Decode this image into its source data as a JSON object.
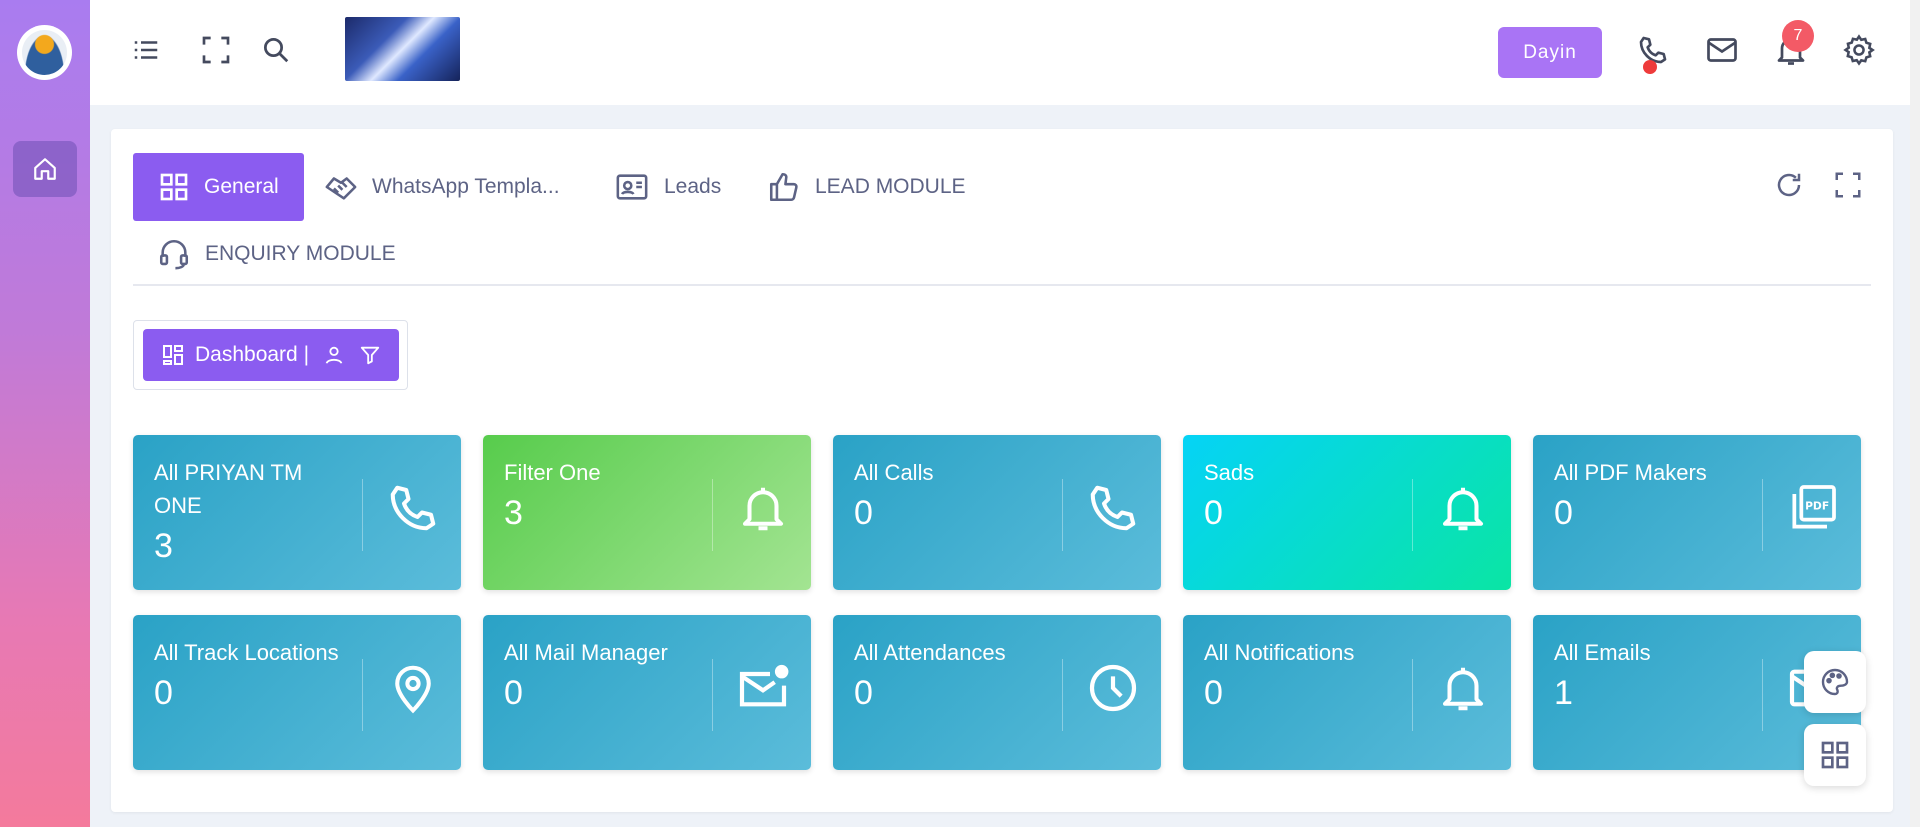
{
  "topbar": {
    "user_button_label": "Dayin",
    "notification_count": "7"
  },
  "tabs": [
    {
      "label": "General",
      "active": true
    },
    {
      "label": "WhatsApp Templa...",
      "active": false
    },
    {
      "label": "Leads",
      "active": false
    },
    {
      "label": "LEAD MODULE",
      "active": false
    },
    {
      "label": "ENQUIRY MODULE",
      "active": false
    }
  ],
  "dashboard": {
    "button_label": "Dashboard |"
  },
  "tiles": [
    {
      "title": "All PRIYAN TM ONE",
      "value": "3",
      "icon": "phone-icon"
    },
    {
      "title": "Filter One",
      "value": "3",
      "icon": "bell-icon"
    },
    {
      "title": "All Calls",
      "value": "0",
      "icon": "phone-icon"
    },
    {
      "title": "Sads",
      "value": "0",
      "icon": "bell-icon"
    },
    {
      "title": "All PDF Makers",
      "value": "0",
      "icon": "pdf-icon"
    },
    {
      "title": "All Track Locations",
      "value": "0",
      "icon": "location-pin-icon"
    },
    {
      "title": "All Mail Manager",
      "value": "0",
      "icon": "mail-icon"
    },
    {
      "title": "All Attendances",
      "value": "0",
      "icon": "clock-icon"
    },
    {
      "title": "All Notifications",
      "value": "0",
      "icon": "bell-icon"
    },
    {
      "title": "All Emails",
      "value": "1",
      "icon": "mail-icon"
    }
  ],
  "colors": {
    "sidebar_top": "#a97cf0",
    "sidebar_bottom": "#f47a9c",
    "accent": "#8b5cf0",
    "tile_blue": "#2aa2c6",
    "tile_green": "#57cc4c",
    "tile_cyan": "#05d3f6",
    "badge": "#f35a66"
  }
}
